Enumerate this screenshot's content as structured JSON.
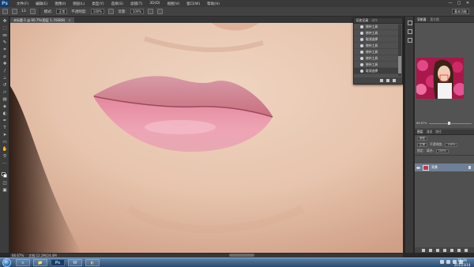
{
  "app": {
    "logo": "Ps",
    "menus": [
      "文件(F)",
      "编辑(E)",
      "图像(I)",
      "图层(L)",
      "类型(Y)",
      "选择(S)",
      "滤镜(T)",
      "3D(D)",
      "视图(V)",
      "窗口(W)",
      "帮助(H)"
    ],
    "window_controls": [
      "—",
      "□",
      "✕"
    ]
  },
  "options": {
    "size_value": "13",
    "mode_label": "模式:",
    "mode_value": "正常",
    "opacity_label": "不透明度:",
    "opacity_value": "100%",
    "flow_label": "流量:",
    "flow_value": "100%",
    "workspace": "基本功能"
  },
  "document": {
    "tab_title": "未标题-1 @ 66.7%(图层 1, RGB/8)",
    "close_glyph": "×",
    "zoom_status": "66.67%",
    "doc_status": "文档:12.2M/24.4M"
  },
  "history": {
    "tabs": [
      "历史记录",
      "动作"
    ],
    "items": [
      "修补工具",
      "修补工具",
      "取消选择",
      "修补工具",
      "修补工具",
      "修补工具",
      "修补工具",
      "取消选择"
    ]
  },
  "navigator": {
    "tabs": [
      "导航器",
      "直方图"
    ],
    "zoom": "66.67%"
  },
  "layers": {
    "tabs": [
      "图层",
      "通道",
      "路径"
    ],
    "kind_label": "类型",
    "blend_mode": "正常",
    "opacity_label": "不透明度:",
    "opacity_value": "100%",
    "lock_label": "锁定:",
    "fill_label": "填充:",
    "fill_value": "100%",
    "layer_name": "背景"
  },
  "taskbar": {
    "apps": [
      "e",
      "📁",
      "Ps",
      "W",
      "◐"
    ],
    "time": "15:26",
    "date": "2015/3/14"
  },
  "colors": {
    "accent": "#6f7f95",
    "ps_blue": "#1c3b63",
    "lip_pink": "#e48aa0",
    "skin": "#e3bfa7"
  }
}
